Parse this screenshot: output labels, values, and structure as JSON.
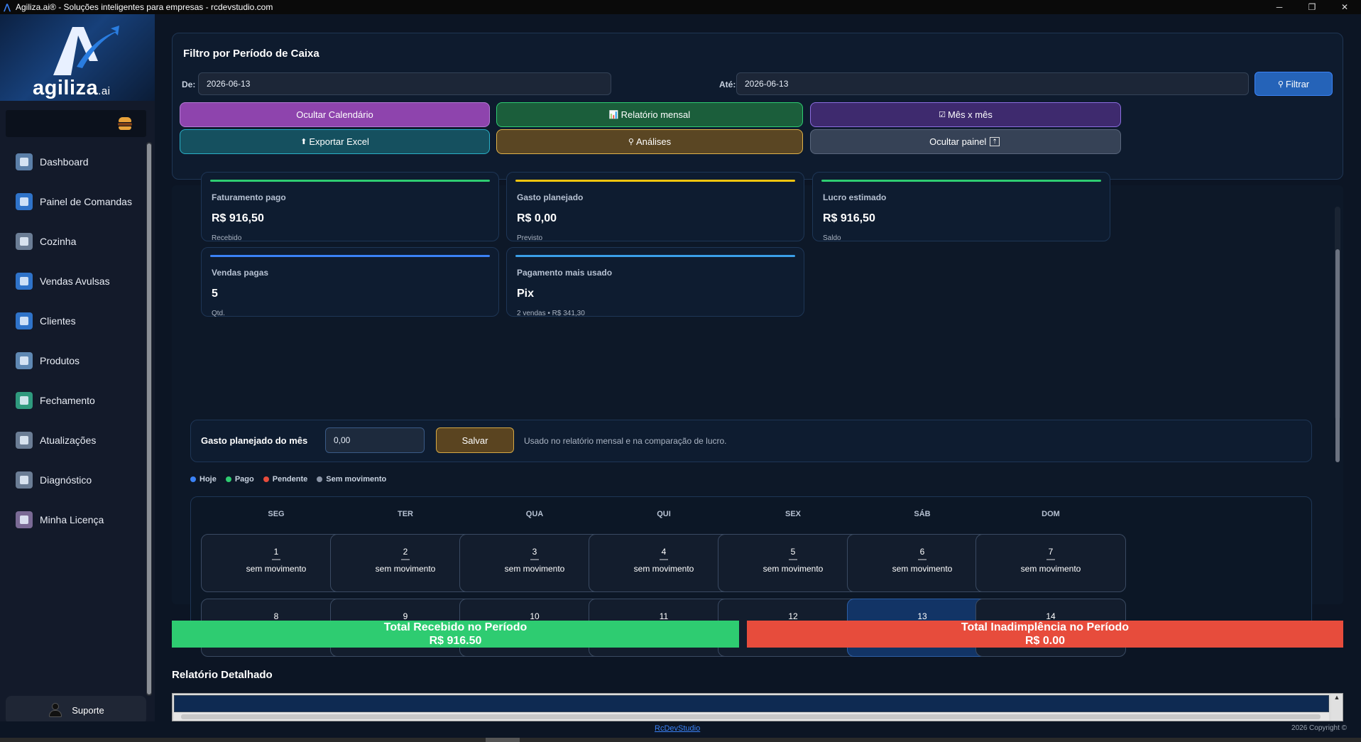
{
  "window": {
    "title": "Agiliza.ai® - Soluções inteligentes para empresas - rcdevstudio.com",
    "icon": "agiliza-app-icon",
    "controls": [
      "─",
      "❐",
      "✕"
    ]
  },
  "brand": {
    "name": "agiliza",
    "suffix": ".ai",
    "accent": "#3b82f6"
  },
  "sidebar": {
    "items": [
      {
        "label": "Dashboard",
        "icon": "dashboard-icon",
        "color": "#5b7fa8"
      },
      {
        "label": "Painel de Comandas",
        "icon": "commands-panel-icon",
        "color": "#2f73c9"
      },
      {
        "label": "Cozinha",
        "icon": "kitchen-icon",
        "color": "#6b7d95"
      },
      {
        "label": "Vendas Avulsas",
        "icon": "sales-icon",
        "color": "#2f73c9"
      },
      {
        "label": "Clientes",
        "icon": "clients-icon",
        "color": "#2f73c9"
      },
      {
        "label": "Produtos",
        "icon": "products-icon",
        "color": "#5f88b3"
      },
      {
        "label": "Fechamento",
        "icon": "closing-icon",
        "color": "#2f9a7e"
      },
      {
        "label": "Atualizações",
        "icon": "updates-icon",
        "color": "#6b7d95"
      },
      {
        "label": "Diagnóstico",
        "icon": "diagnostic-icon",
        "color": "#6b7d95"
      },
      {
        "label": "Minha Licença",
        "icon": "license-icon",
        "color": "#7a6a95"
      }
    ],
    "support_label": "Suporte"
  },
  "filter": {
    "title": "Filtro por Período de Caixa",
    "from_label": "De:",
    "from_value": "2026-06-13",
    "to_label": "Até:",
    "to_value": "2026-06-13",
    "filter_button": "Filtrar",
    "actions": [
      {
        "label": "Ocultar Calendário",
        "icon": "",
        "bg": "#8e44ad",
        "border": "#b57bd6"
      },
      {
        "label": "Relatório mensal",
        "icon": "📊",
        "bg": "#1b5e3b",
        "border": "#2ecc71"
      },
      {
        "label": "Mês x mês",
        "icon": "☑",
        "bg": "#3e2a6e",
        "border": "#8b6ee0"
      },
      {
        "label": "Exportar Excel",
        "icon": "⬆",
        "bg": "#15505f",
        "border": "#2ab0c7"
      },
      {
        "label": "Análises",
        "icon": "⚲",
        "bg": "#5a4623",
        "border": "#e0b34a"
      },
      {
        "label": "Ocultar painel",
        "icon": "⇡",
        "bg": "#364256",
        "border": "#5a677d"
      }
    ]
  },
  "cards": [
    {
      "title": "Faturamento pago",
      "value": "R$ 916,50",
      "sub": "Recebido",
      "accent": "#2ecc71"
    },
    {
      "title": "Gasto planejado",
      "value": "R$ 0,00",
      "sub": "Previsto",
      "accent": "#f1c40f"
    },
    {
      "title": "Lucro estimado",
      "value": "R$ 916,50",
      "sub": "Saldo",
      "accent": "#2ecc71"
    },
    {
      "title": "Vendas pagas",
      "value": "5",
      "sub": "Qtd.",
      "accent": "#3b82f6"
    },
    {
      "title": "Pagamento mais usado",
      "value": "Pix",
      "sub": "2 vendas • R$ 341,30",
      "accent": "#3b9fe8"
    }
  ],
  "planned": {
    "label": "Gasto planejado do mês",
    "value": "0,00",
    "save": "Salvar",
    "note": "Usado no relatório mensal e na comparação de lucro."
  },
  "legend": [
    {
      "label": "Hoje",
      "color": "#3b82f6"
    },
    {
      "label": "Pago",
      "color": "#2ecc71"
    },
    {
      "label": "Pendente",
      "color": "#e74c3c"
    },
    {
      "label": "Sem movimento",
      "color": "#8a94a6"
    }
  ],
  "calendar": {
    "weekdays": [
      "SEG",
      "TER",
      "QUA",
      "QUI",
      "SEX",
      "SÁB",
      "DOM"
    ],
    "week1": [
      {
        "day": "1",
        "status": "sem movimento"
      },
      {
        "day": "2",
        "status": "sem movimento"
      },
      {
        "day": "3",
        "status": "sem movimento"
      },
      {
        "day": "4",
        "status": "sem movimento"
      },
      {
        "day": "5",
        "status": "sem movimento"
      },
      {
        "day": "6",
        "status": "sem movimento"
      },
      {
        "day": "7",
        "status": "sem movimento"
      }
    ],
    "week2": [
      "8",
      "9",
      "10",
      "11",
      "12",
      "13",
      "14"
    ],
    "today": "13"
  },
  "totals": {
    "received_label": "Total Recebido no Período",
    "received_value": "R$ 916.50",
    "default_label": "Total Inadimplência no Período",
    "default_value": "R$ 0.00"
  },
  "report": {
    "title": "Relatório Detalhado"
  },
  "footer": {
    "link": "RcDevStudio",
    "copyright": "2026 Copyright ©"
  }
}
